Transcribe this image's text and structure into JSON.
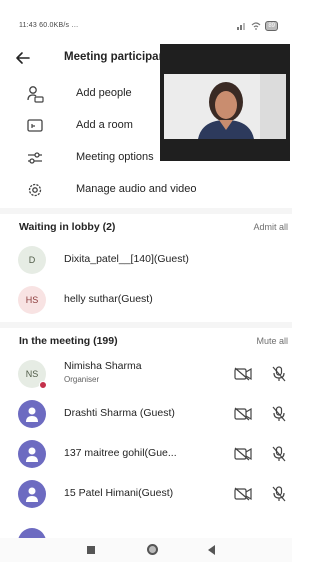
{
  "status_bar": {
    "time": "11:43",
    "speed": "60.0KB/s",
    "extra": "…",
    "battery": "89"
  },
  "header": {
    "title": "Meeting participants"
  },
  "menu": [
    {
      "label": "Add people",
      "icon": "add-person-icon"
    },
    {
      "label": "Add a room",
      "icon": "room-icon"
    },
    {
      "label": "Meeting options",
      "icon": "sliders-icon"
    },
    {
      "label": "Manage audio and video",
      "icon": "gear-icon"
    }
  ],
  "lobby": {
    "title": "Waiting in lobby (2)",
    "action": "Admit all",
    "people": [
      {
        "initials": "D",
        "name": "Dixita_patel__[140](Guest)"
      },
      {
        "initials": "HS",
        "name": "helly suthar(Guest)"
      }
    ]
  },
  "meeting": {
    "title": "In the meeting (199)",
    "action": "Mute all",
    "people": [
      {
        "initials": "NS",
        "name": "Nimisha  Sharma",
        "role": "Organiser"
      },
      {
        "initials": "",
        "name": "Drashti Sharma (Guest)"
      },
      {
        "initials": "",
        "name": "137 maitree gohil(Gue..."
      },
      {
        "initials": "",
        "name": "15 Patel Himani(Guest)"
      }
    ]
  }
}
